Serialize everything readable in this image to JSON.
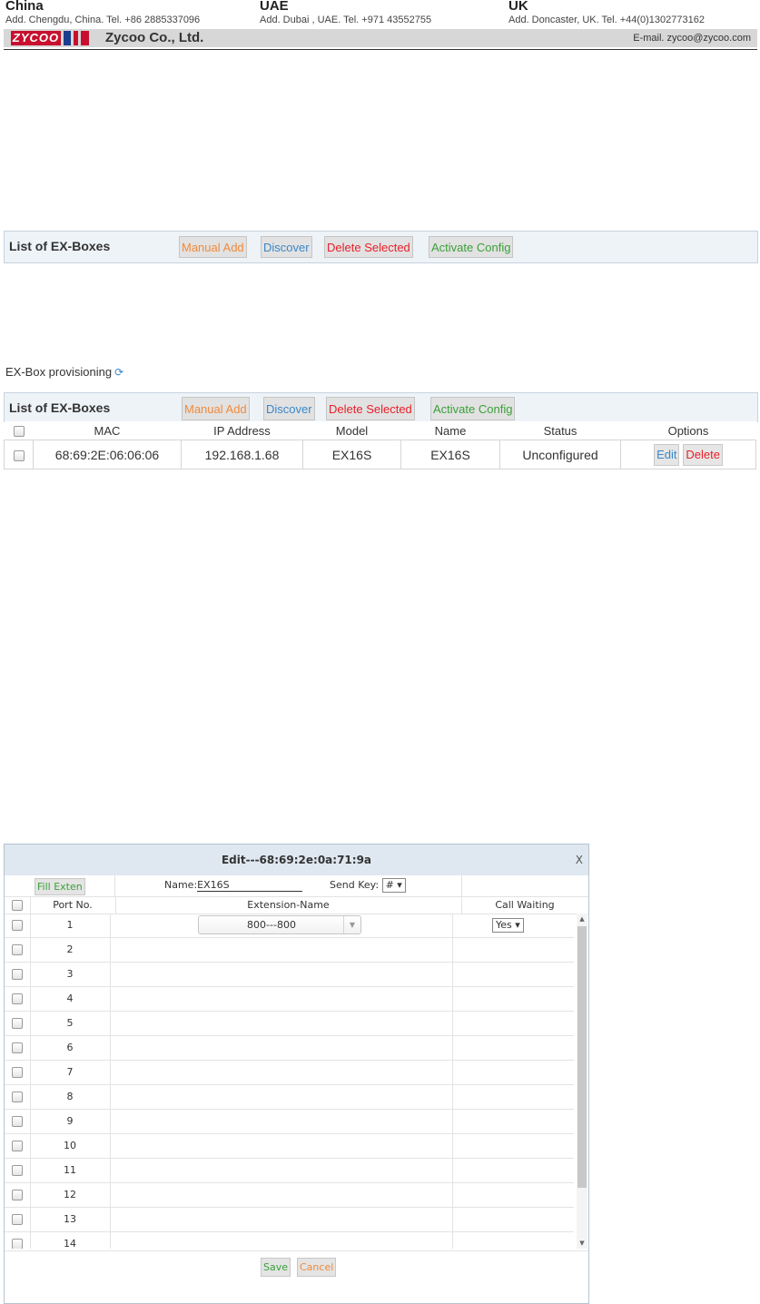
{
  "header": {
    "offices": [
      {
        "country": "China",
        "address": "Add. Chengdu, China.   Tel. +86 2885337096"
      },
      {
        "country": "UAE",
        "address": "Add. Dubai , UAE.   Tel. +971 43552755"
      },
      {
        "country": "UK",
        "address": "Add. Doncaster, UK.   Tel. +44(0)1302773162"
      }
    ],
    "logo_text": "ZYCOO",
    "company": "Zycoo  Co., Ltd.",
    "email": "E-mail. zycoo@zycoo.com",
    "brand_color": "#c8102e"
  },
  "toolbar": {
    "title": "List of EX-Boxes",
    "manual_add": "Manual Add",
    "discover": "Discover",
    "delete_selected": "Delete Selected",
    "activate_config": "Activate Config"
  },
  "provisioning": {
    "label": "EX-Box provisioning",
    "refresh_icon": "refresh-icon"
  },
  "table": {
    "columns": [
      "MAC",
      "IP Address",
      "Model",
      "Name",
      "Status",
      "Options"
    ],
    "rows": [
      {
        "mac": "68:69:2E:06:06:06",
        "ip": "192.168.1.68",
        "model": "EX16S",
        "name": "EX16S",
        "status": "Unconfigured",
        "edit": "Edit",
        "delete": "Delete"
      }
    ]
  },
  "dialog": {
    "title": "Edit---68:69:2e:0a:71:9a",
    "close": "X",
    "fill_exten": "Fill Exten",
    "name_label": "Name:",
    "name_value": "EX16S",
    "send_key_label": "Send Key:",
    "send_key_value": "#",
    "col_port": "Port No.",
    "col_extension": "Extension-Name",
    "col_call_waiting": "Call Waiting",
    "rows": [
      {
        "port": "1",
        "extension": "800---800",
        "call_waiting": "Yes"
      },
      {
        "port": "2"
      },
      {
        "port": "3"
      },
      {
        "port": "4"
      },
      {
        "port": "5"
      },
      {
        "port": "6"
      },
      {
        "port": "7"
      },
      {
        "port": "8"
      },
      {
        "port": "9"
      },
      {
        "port": "10"
      },
      {
        "port": "11"
      },
      {
        "port": "12"
      },
      {
        "port": "13"
      },
      {
        "port": "14"
      }
    ],
    "save": "Save",
    "cancel": "Cancel"
  }
}
